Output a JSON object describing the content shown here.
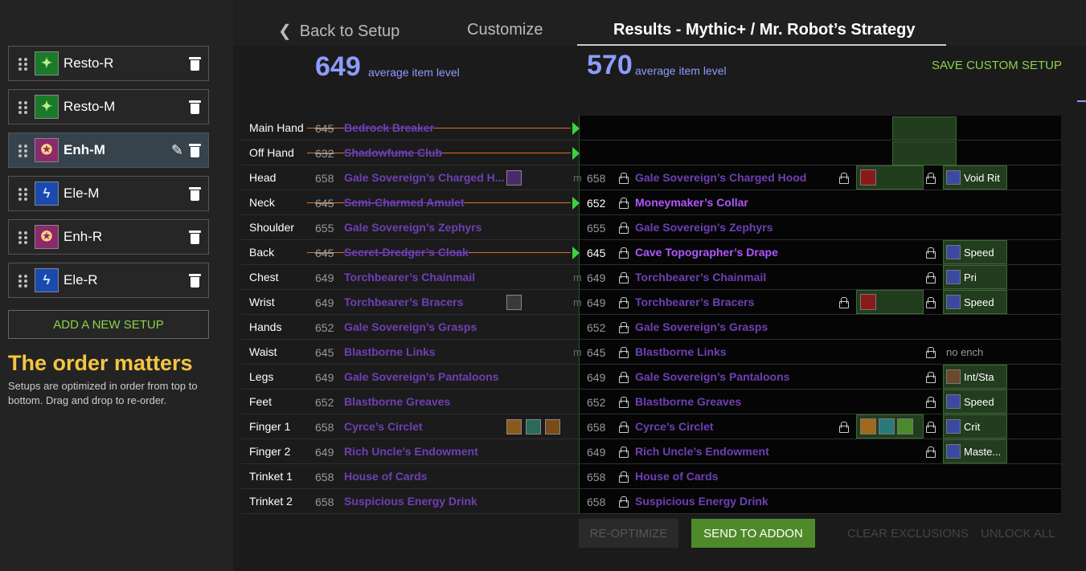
{
  "sidebar": {
    "setups": [
      {
        "name": "Resto-R",
        "icon": "resto-shaman-icon",
        "color": "#1b7a2a"
      },
      {
        "name": "Resto-M",
        "icon": "resto-shaman-icon",
        "color": "#1b7a2a"
      },
      {
        "name": "Enh-M",
        "icon": "enhancement-shaman-icon",
        "color": "#8a2a6a",
        "active": true
      },
      {
        "name": "Ele-M",
        "icon": "elemental-shaman-icon",
        "color": "#1a4ab0"
      },
      {
        "name": "Enh-R",
        "icon": "enhancement-shaman-icon",
        "color": "#8a2a6a"
      },
      {
        "name": "Ele-R",
        "icon": "elemental-shaman-icon",
        "color": "#1a4ab0"
      }
    ],
    "add_setup_label": "ADD A NEW SETUP",
    "order_title": "The order matters",
    "order_desc": "Setups are optimized in order from top to bottom. Drag and drop to re-order."
  },
  "tabs": {
    "back": "Back to Setup",
    "customize": "Customize",
    "results": "Results - Mythic+ / Mr. Robot’s Strategy"
  },
  "summary": {
    "left_ilvl": "649",
    "right_ilvl": "570",
    "ilvl_label": "average item level",
    "save_custom": "SAVE CUSTOM SETUP"
  },
  "gear_rows": [
    {
      "slot": "Main Hand",
      "ilvl": "645",
      "item": "Bedrock Breaker",
      "struck": true
    },
    {
      "slot": "Off Hand",
      "ilvl": "632",
      "item": "Shadowfume Club",
      "struck": true
    },
    {
      "slot": "Head",
      "ilvl": "658",
      "item": "Gale Sovereign’s Charged H...",
      "new_ilvl": "658",
      "new_item": "Gale Sovereign’s Charged Hood",
      "enchant": "Void Rit"
    },
    {
      "slot": "Neck",
      "ilvl": "645",
      "item": "Semi-Charmed Amulet",
      "struck": true,
      "new_ilvl": "652",
      "new_item": "Moneymaker’s Collar"
    },
    {
      "slot": "Shoulder",
      "ilvl": "655",
      "item": "Gale Sovereign’s Zephyrs",
      "new_ilvl": "655",
      "new_item": "Gale Sovereign’s Zephyrs"
    },
    {
      "slot": "Back",
      "ilvl": "645",
      "item": "Secret-Dredger’s Cloak",
      "struck": true,
      "new_ilvl": "645",
      "new_item": "Cave Topographer’s Drape",
      "enchant": "Speed"
    },
    {
      "slot": "Chest",
      "ilvl": "649",
      "item": "Torchbearer’s Chainmail",
      "new_ilvl": "649",
      "new_item": "Torchbearer’s Chainmail",
      "enchant": "Pri"
    },
    {
      "slot": "Wrist",
      "ilvl": "649",
      "item": "Torchbearer’s Bracers",
      "new_ilvl": "649",
      "new_item": "Torchbearer’s Bracers",
      "enchant": "Speed"
    },
    {
      "slot": "Hands",
      "ilvl": "652",
      "item": "Gale Sovereign’s Grasps",
      "new_ilvl": "652",
      "new_item": "Gale Sovereign’s Grasps"
    },
    {
      "slot": "Waist",
      "ilvl": "645",
      "item": "Blastborne Links",
      "new_ilvl": "645",
      "new_item": "Blastborne Links",
      "no_enchant": "no ench"
    },
    {
      "slot": "Legs",
      "ilvl": "649",
      "item": "Gale Sovereign’s Pantaloons",
      "new_ilvl": "649",
      "new_item": "Gale Sovereign’s Pantaloons",
      "enchant": "Int/Sta"
    },
    {
      "slot": "Feet",
      "ilvl": "652",
      "item": "Blastborne Greaves",
      "new_ilvl": "652",
      "new_item": "Blastborne Greaves",
      "enchant": "Speed"
    },
    {
      "slot": "Finger 1",
      "ilvl": "658",
      "item": "Cyrce’s Circlet",
      "new_ilvl": "658",
      "new_item": "Cyrce’s Circlet",
      "enchant": "Crit"
    },
    {
      "slot": "Finger 2",
      "ilvl": "649",
      "item": "Rich Uncle’s Endowment",
      "new_ilvl": "649",
      "new_item": "Rich Uncle’s Endowment",
      "enchant": "Maste..."
    },
    {
      "slot": "Trinket 1",
      "ilvl": "658",
      "item": "House of Cards",
      "new_ilvl": "658",
      "new_item": "House of Cards"
    },
    {
      "slot": "Trinket 2",
      "ilvl": "658",
      "item": "Suspicious Energy Drink",
      "new_ilvl": "658",
      "new_item": "Suspicious Energy Drink"
    }
  ],
  "row_marker": "m",
  "buttons": {
    "reoptimize": "RE-OPTIMIZE",
    "send": "SEND TO ADDON",
    "clear": "CLEAR EXCLUSIONS",
    "unlock": "UNLOCK ALL"
  },
  "colors": {
    "accent_green": "#8bd24b",
    "ilvl_blue": "#8c9cff",
    "item_purple": "#6f3fb5",
    "new_item_purple": "#b057ff",
    "order_yellow": "#f4c542",
    "strike_orange": "#e07020"
  }
}
